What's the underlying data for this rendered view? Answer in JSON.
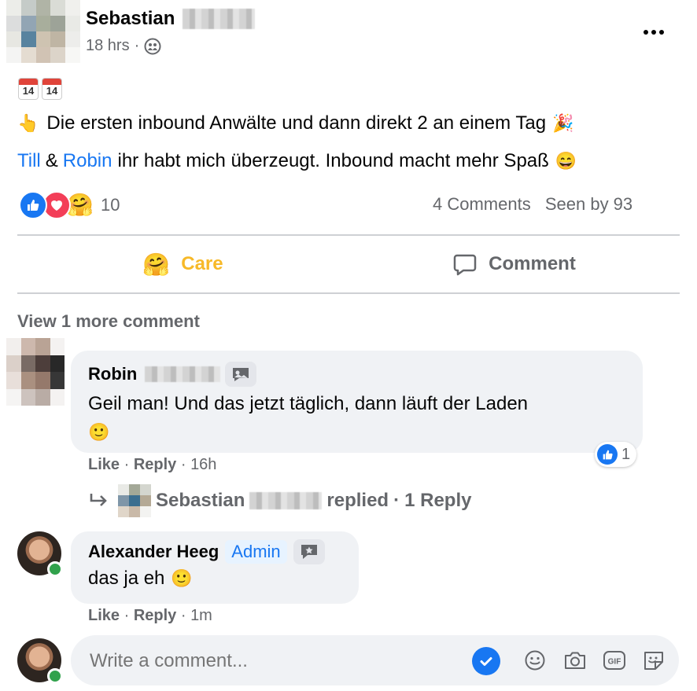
{
  "post": {
    "author_first": "Sebastian",
    "time": "18 hrs",
    "separator": "·",
    "calendar_labels": [
      "MAY 14",
      "MAY 14"
    ],
    "line1": "Die ersten inbound Anwälte und dann direkt 2 an einem Tag",
    "line2_name1": "Till",
    "line2_amp": "&",
    "line2_name2": "Robin",
    "line2_rest": "ihr habt mich überzeugt. Inbound macht mehr Spaß",
    "reaction_count": "10",
    "comments_count": "4 Comments",
    "seen_by": "Seen by 93"
  },
  "actions": {
    "care_label": "Care",
    "comment_label": "Comment"
  },
  "view_more": "View 1 more comment",
  "comments": [
    {
      "author_first": "Robin",
      "text_line1": "Geil man! Und das jetzt täglich, dann läuft der Laden",
      "like_label": "Like",
      "reply_label": "Reply",
      "time": "16h",
      "reaction_count": "1",
      "reply_author_first": "Sebastian",
      "replied_text": "replied",
      "reply_count": "1 Reply"
    },
    {
      "author": "Alexander Heeg",
      "badge": "Admin",
      "text": "das ja eh",
      "like_label": "Like",
      "reply_label": "Reply",
      "time": "1m"
    }
  ],
  "composer": {
    "placeholder": "Write a comment...",
    "icons": [
      "check-icon",
      "emoji-icon",
      "camera-icon",
      "gif-icon",
      "sticker-icon"
    ]
  },
  "colors": {
    "facebook_blue": "#1877f2",
    "care_yellow": "#f7b928",
    "gray_text": "#65676b",
    "bubble_bg": "#f0f2f5",
    "online_green": "#31a24c"
  }
}
